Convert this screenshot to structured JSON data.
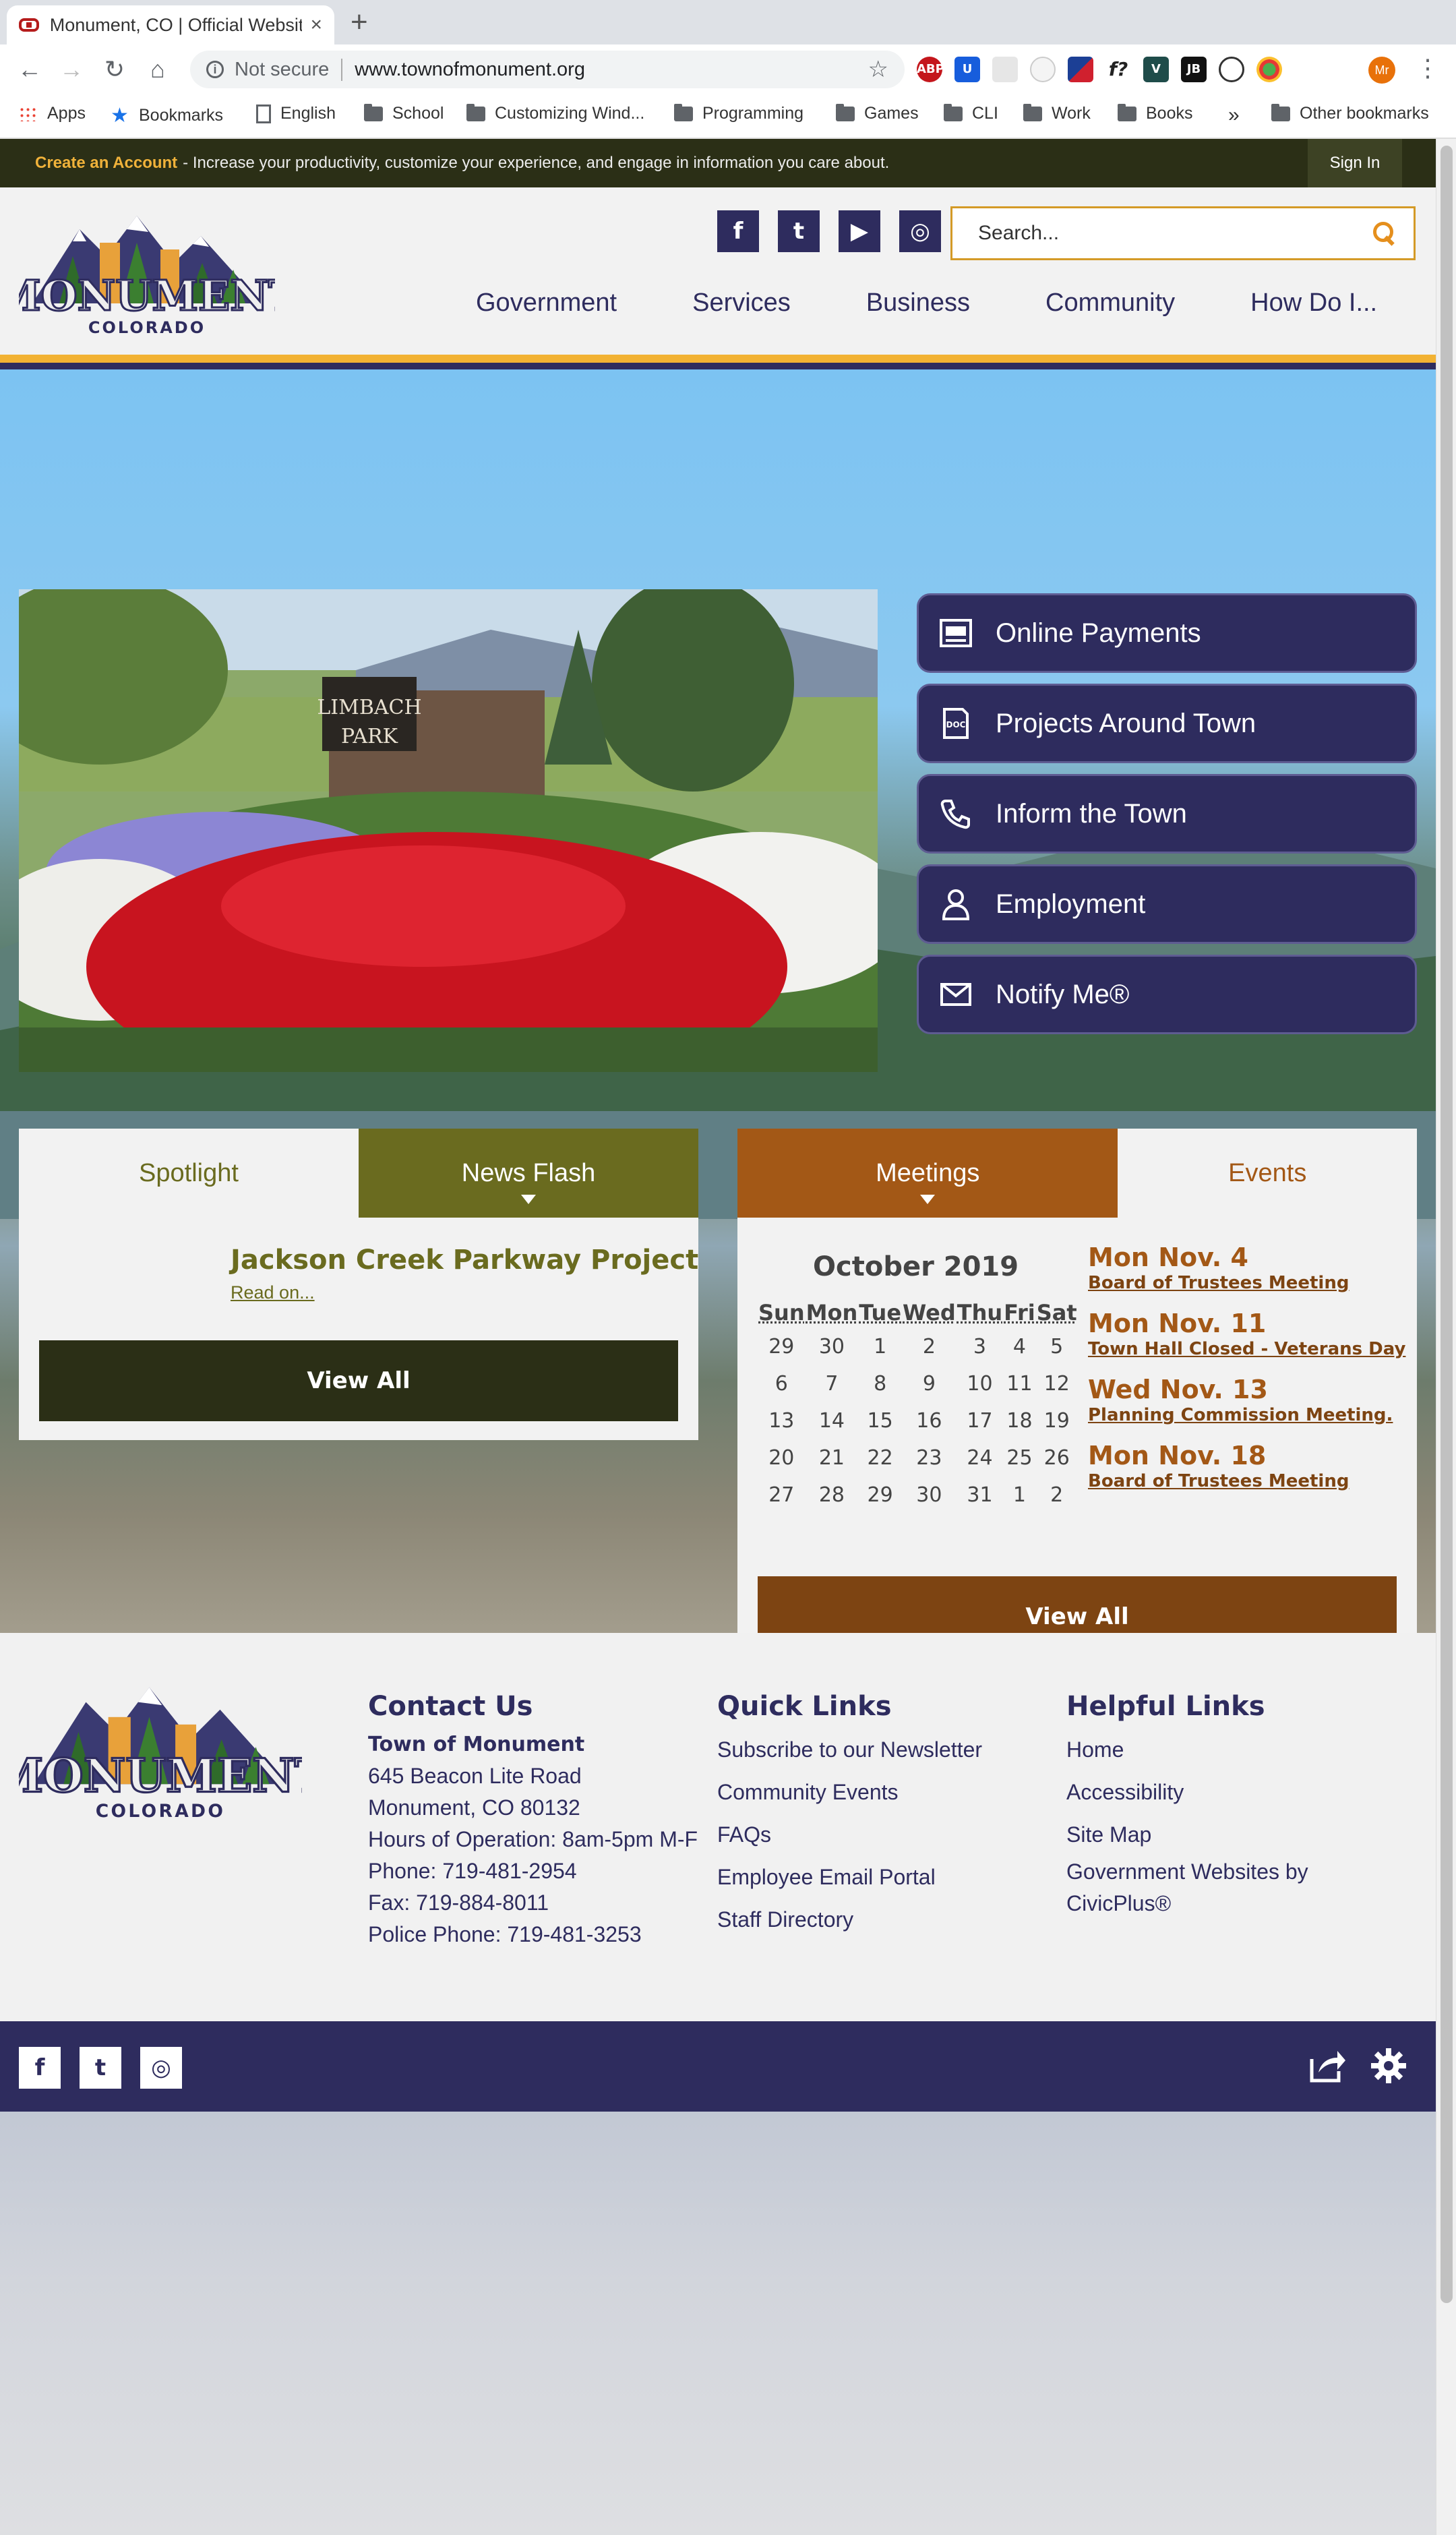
{
  "browser": {
    "tab_title": "Monument, CO | Official Website",
    "tab_close": "×",
    "new_tab": "+",
    "security": "Not secure",
    "url": "www.townofmonument.org",
    "info_glyph": "i",
    "star_glyph": "☆",
    "back_glyph": "←",
    "forward_glyph": "→",
    "reload_glyph": "↻",
    "home_glyph": "⌂",
    "menu_glyph": "⋮",
    "profile_initials": "Mr",
    "extensions": [
      "ABP",
      "U",
      "",
      "",
      "",
      "f?",
      "V",
      "JB",
      "",
      ""
    ],
    "bookmarks": [
      "Apps",
      "Bookmarks",
      "English",
      "School",
      "Customizing Wind...",
      "Programming",
      "Games",
      "CLI",
      "Work",
      "Books"
    ],
    "bookmarks_more": "»",
    "other_bookmarks": "Other bookmarks"
  },
  "account_bar": {
    "create_label": "Create an Account",
    "message": " - Increase your productivity, customize your experience, and engage in information you care about.",
    "sign_in": "Sign In"
  },
  "header": {
    "logo_text_main": "MONUMENT",
    "logo_text_sub": "COLORADO",
    "social": [
      "f",
      "t",
      "▶",
      "◎"
    ],
    "search_placeholder": "Search...",
    "nav": [
      "Government",
      "Services",
      "Business",
      "Community",
      "How Do I..."
    ]
  },
  "hero": {
    "sign_line1": "LIMBACH",
    "sign_line2": "PARK"
  },
  "quick_links": [
    "Online Payments",
    "Projects Around Town",
    "Inform the Town",
    "Employment",
    "Notify Me®"
  ],
  "news_tabs": {
    "tabs": [
      "Spotlight",
      "News Flash"
    ],
    "headline": "Jackson Creek Parkway Project",
    "read_on": "Read on...",
    "view_all": "View All"
  },
  "meetings_tabs": {
    "tabs": [
      "Meetings",
      "Events"
    ],
    "calendar_title": "October 2019",
    "weekdays": [
      "Sun",
      "Mon",
      "Tue",
      "Wed",
      "Thu",
      "Fri",
      "Sat"
    ],
    "weeks": [
      [
        "29",
        "30",
        "1",
        "2",
        "3",
        "4",
        "5"
      ],
      [
        "6",
        "7",
        "8",
        "9",
        "10",
        "11",
        "12"
      ],
      [
        "13",
        "14",
        "15",
        "16",
        "17",
        "18",
        "19"
      ],
      [
        "20",
        "21",
        "22",
        "23",
        "24",
        "25",
        "26"
      ],
      [
        "27",
        "28",
        "29",
        "30",
        "31",
        "1",
        "2"
      ]
    ],
    "events": [
      {
        "date": "Mon Nov. 4",
        "name": "Board of Trustees Meeting"
      },
      {
        "date": "Mon Nov. 11",
        "name": "Town Hall Closed - Veterans Day"
      },
      {
        "date": "Wed Nov. 13",
        "name": "Planning Commission Meeting."
      },
      {
        "date": "Mon Nov. 18",
        "name": "Board of Trustees Meeting"
      }
    ],
    "view_all": "View All"
  },
  "footer": {
    "contact": {
      "heading": "Contact Us",
      "org": "Town of Monument",
      "lines": [
        "645 Beacon Lite Road",
        "Monument, CO 80132",
        "Hours of Operation: 8am-5pm M-F",
        "Phone: 719-481-2954",
        "Fax: 719-884-8011",
        "Police Phone: 719-481-3253"
      ]
    },
    "quick_links": {
      "heading": "Quick Links",
      "items": [
        "Subscribe to our Newsletter",
        "Community Events",
        "FAQs",
        "Employee Email Portal",
        "Staff Directory"
      ]
    },
    "helpful_links": {
      "heading": "Helpful Links",
      "items": [
        "Home",
        "Accessibility",
        "Site Map",
        "Government Websites by",
        "CivicPlus®"
      ]
    },
    "bottom_social": [
      "f",
      "t",
      "◎"
    ]
  },
  "colors": {
    "navy": "#2e2c5e",
    "olive": "#6a6b1f",
    "dark_olive": "#2b2f16",
    "rust": "#a35816",
    "brown": "#7d4412",
    "gold": "#f2b233"
  }
}
